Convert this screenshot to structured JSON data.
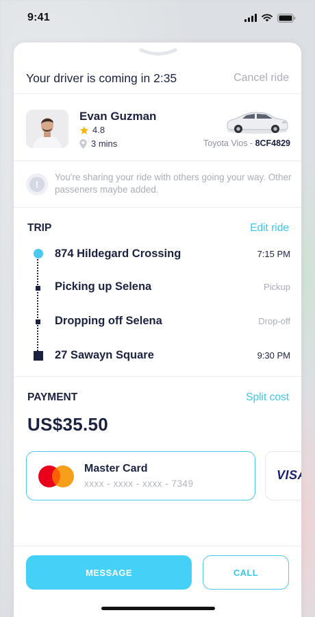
{
  "status_bar": {
    "time": "9:41"
  },
  "header": {
    "title": "Your driver is coming in 2:35",
    "cancel_label": "Cancel ride"
  },
  "driver": {
    "name": "Evan Guzman",
    "rating": "4.8",
    "eta": "3 mins",
    "car_model": "Toyota Vios - ",
    "plate": "8CF4829"
  },
  "notice": {
    "text": "You're sharing your ride with others going your way. Other passeners maybe added."
  },
  "trip": {
    "title": "TRIP",
    "edit_label": "Edit ride",
    "stops": [
      {
        "label": "874 Hildegard Crossing",
        "meta": "7:15 PM"
      },
      {
        "label": "Picking up Selena",
        "meta": "Pickup"
      },
      {
        "label": "Dropping off Selena",
        "meta": "Drop-off"
      },
      {
        "label": "27 Sawayn Square",
        "meta": "9:30 PM"
      }
    ]
  },
  "payment": {
    "title": "PAYMENT",
    "split_label": "Split cost",
    "amount": "US$35.50",
    "cards": [
      {
        "name": "Master Card",
        "number": "xxxx - xxxx - xxxx - 7349",
        "selected": true
      },
      {
        "brand": "VISA"
      }
    ]
  },
  "actions": {
    "message_label": "MESSAGE",
    "call_label": "CALL"
  },
  "colors": {
    "accent": "#45d1f7",
    "navy": "#1b2240",
    "muted": "#a9adb7"
  }
}
